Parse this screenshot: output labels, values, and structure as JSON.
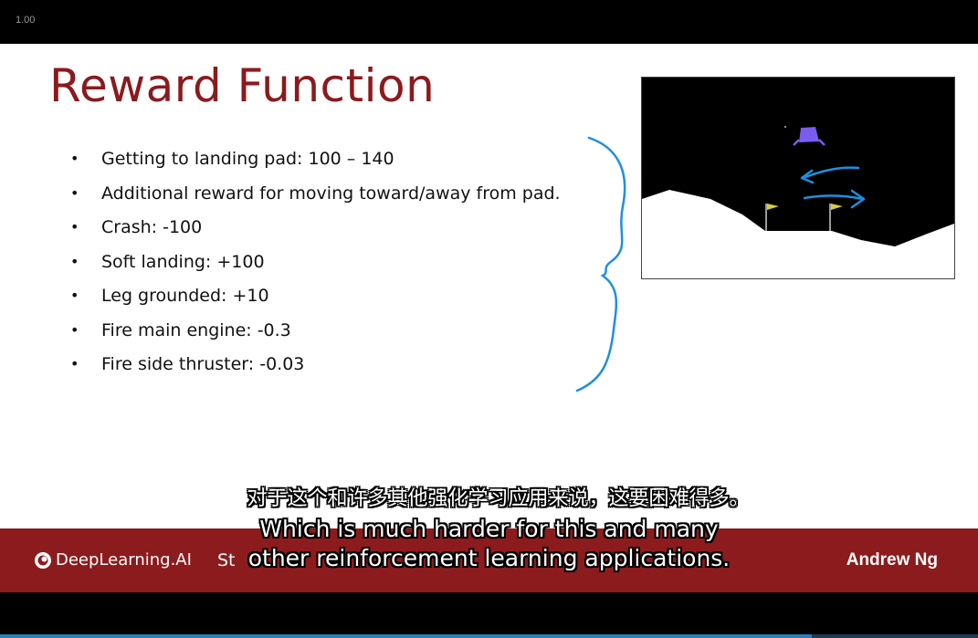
{
  "player": {
    "speed": "1.00",
    "progress": 0.83
  },
  "slide": {
    "title": "Reward Function",
    "bullets": [
      "Getting to landing pad: 100 – 140",
      "Additional reward for moving toward/away from pad.",
      "Crash: -100",
      "Soft landing: +100",
      "Leg grounded: +10",
      "Fire main engine: -0.3",
      "Fire side thruster: -0.03"
    ],
    "bullet_symbol": "•"
  },
  "footer": {
    "logo_text": "DeepLearning.AI",
    "partial_text": "St",
    "author": "Andrew Ng"
  },
  "subtitles": {
    "zh": "对于这个和许多其他强化学习应用来说，这要困难得多。",
    "en_line1": "Which is much harder for this and many",
    "en_line2": "other reinforcement learning applications."
  },
  "colors": {
    "title": "#8b1a1d",
    "footer_bg": "#8c1b1d",
    "annotation_blue": "#1e8fe0",
    "lander": "#7b5cf0",
    "flag": "#d8cc3a"
  }
}
